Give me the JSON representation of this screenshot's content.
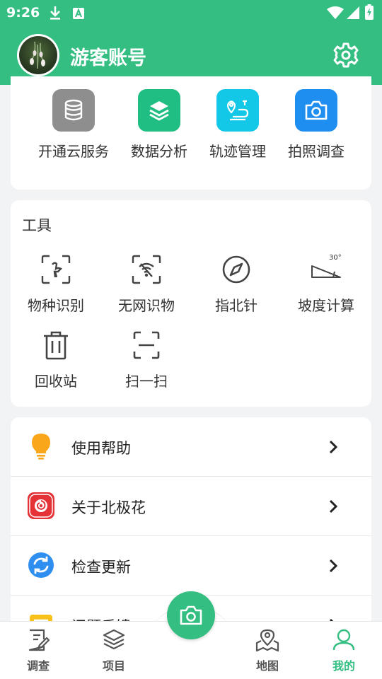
{
  "status_bar": {
    "time": "9:26"
  },
  "header": {
    "title": "游客账号"
  },
  "quick_actions": [
    {
      "label": "开通云服务",
      "icon": "database-icon",
      "color": "#8e8e8e"
    },
    {
      "label": "数据分析",
      "icon": "layers-icon",
      "color": "#20be82"
    },
    {
      "label": "轨迹管理",
      "icon": "route-icon",
      "color": "#13c8e6"
    },
    {
      "label": "拍照调查",
      "icon": "camera-icon",
      "color": "#1f8ef1"
    }
  ],
  "tools": {
    "title": "工具",
    "items": [
      {
        "label": "物种识别",
        "icon": "species-scan-icon"
      },
      {
        "label": "无网识物",
        "icon": "offline-scan-icon"
      },
      {
        "label": "指北针",
        "icon": "compass-icon"
      },
      {
        "label": "坡度计算",
        "icon": "slope-icon",
        "angle_text": "30°"
      },
      {
        "label": "回收站",
        "icon": "trash-icon"
      },
      {
        "label": "扫一扫",
        "icon": "scan-icon"
      }
    ]
  },
  "menu": [
    {
      "label": "使用帮助",
      "icon": "lightbulb-icon"
    },
    {
      "label": "关于北极花",
      "icon": "app-logo-icon"
    },
    {
      "label": "检查更新",
      "icon": "refresh-icon"
    },
    {
      "label": "问题反馈",
      "icon": "feedback-icon"
    }
  ],
  "bottom_nav": {
    "items": [
      {
        "label": "调查",
        "icon": "survey-icon"
      },
      {
        "label": "项目",
        "icon": "layers-icon"
      },
      {
        "label": "地图",
        "icon": "map-pin-icon"
      },
      {
        "label": "我的",
        "icon": "user-icon",
        "active": true
      }
    ],
    "center_icon": "camera-icon"
  },
  "colors": {
    "brand": "#34be82",
    "background": "#f2f3f5"
  }
}
